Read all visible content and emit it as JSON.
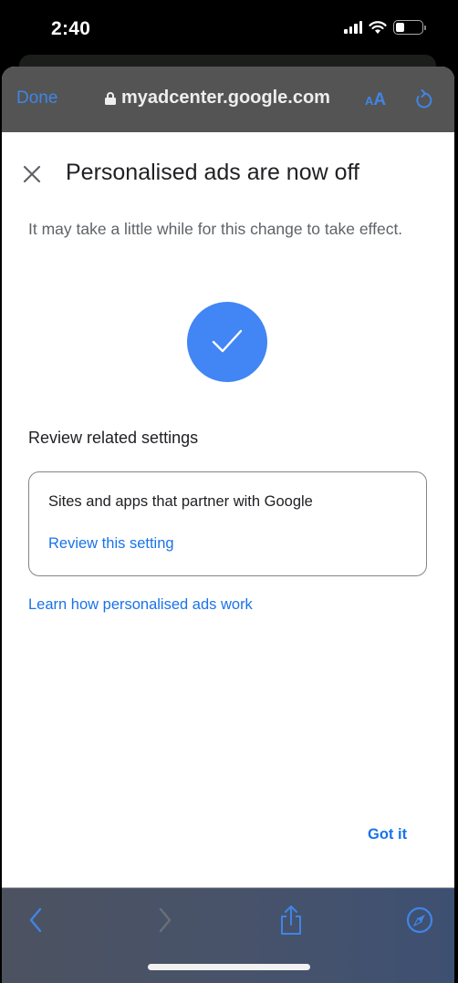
{
  "status_bar": {
    "time": "2:40",
    "signal_icon": "cellular-signal-icon",
    "wifi_icon": "wifi-icon",
    "battery_icon": "battery-icon",
    "battery_level_fraction": 0.35
  },
  "browser_nav": {
    "done_label": "Done",
    "lock_icon": "lock-icon",
    "url": "myadcenter.google.com",
    "text_size_label_small": "A",
    "text_size_label_big": "A",
    "reload_icon": "reload-icon"
  },
  "dialog": {
    "close_icon": "close-icon",
    "title": "Personalised ads are now off",
    "description": "It may take a little while for this change to take effect.",
    "success_icon": "checkmark-icon",
    "section_title": "Review related settings",
    "setting_card": {
      "title": "Sites and apps that partner with Google",
      "link_label": "Review this setting"
    },
    "learn_link": "Learn how personalised ads work",
    "confirm_label": "Got it"
  },
  "toolbar": {
    "back_icon": "chevron-left-icon",
    "forward_icon": "chevron-right-icon",
    "share_icon": "share-icon",
    "safari_icon": "compass-icon"
  },
  "colors": {
    "accent": "#1a73e8",
    "ios_blue": "#3f85e6",
    "check_circle": "#4285f4",
    "nav_bar": "#545454"
  }
}
